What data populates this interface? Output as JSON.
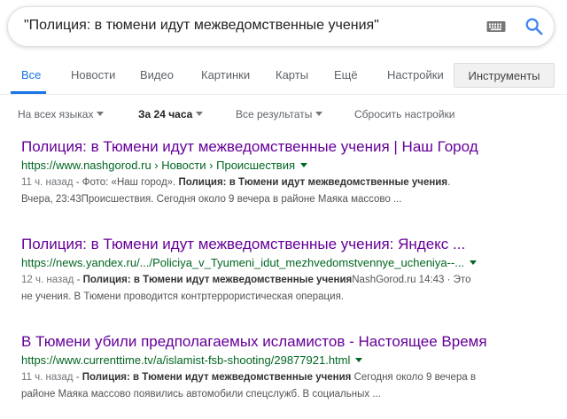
{
  "search": {
    "query": "\"Полиция: в тюмени идут межведомственные учения\""
  },
  "icons": {
    "keyboard": "keyboard-icon",
    "search": "search-icon"
  },
  "colors": {
    "accent": "#1a73e8",
    "visited_link": "#660099",
    "url": "#006621"
  },
  "tabs": [
    {
      "label": "Все"
    },
    {
      "label": "Новости"
    },
    {
      "label": "Видео"
    },
    {
      "label": "Картинки"
    },
    {
      "label": "Карты"
    },
    {
      "label": "Ещё"
    },
    {
      "label": "Настройки"
    }
  ],
  "tools_label": "Инструменты",
  "filters": {
    "language": "На всех языках",
    "time": "За 24 часа",
    "results": "Все результаты",
    "reset": "Сбросить настройки"
  },
  "results": [
    {
      "title": "Полиция: в Тюмени идут межведомственные учения | Наш Город",
      "url": "https://www.nashgorod.ru › Новости › Происшествия",
      "date": "11 ч. назад",
      "line1_pre": " - Фото: «Наш город». ",
      "line1_bold": "Полиция: в Тюмени идут межведомственные учения",
      "line1_post": ".",
      "line2": "Вчера, 23:43Происшествия. Сегодня около 9 вечера в районе Маяка массово ..."
    },
    {
      "title": "Полиция: в Тюмени идут межведомственные учения: Яндекс ...",
      "url": "https://news.yandex.ru/.../Policiya_v_Tyumeni_idut_mezhvedomstvennye_ucheniya--...",
      "date": "12 ч. назад",
      "line1_pre": " - ",
      "line1_bold": "Полиция: в Тюмени идут межведомственные учения",
      "line1_post": "NashGorod.ru 14:43 · Это",
      "line2": "не учения. В Тюмени проводится контртеррористическая операция."
    },
    {
      "title": "В Тюмени убили предполагаемых исламистов - Настоящее Время",
      "url": "https://www.currenttime.tv/a/islamist-fsb-shooting/29877921.html",
      "date": "11 ч. назад",
      "line1_pre": " - ",
      "line1_bold": "Полиция: в Тюмени идут межведомственные учения",
      "line1_post": " Сегодня около 9 вечера в",
      "line2": "районе Маяка массово появились автомобили спецслужб. В социальных ..."
    }
  ]
}
